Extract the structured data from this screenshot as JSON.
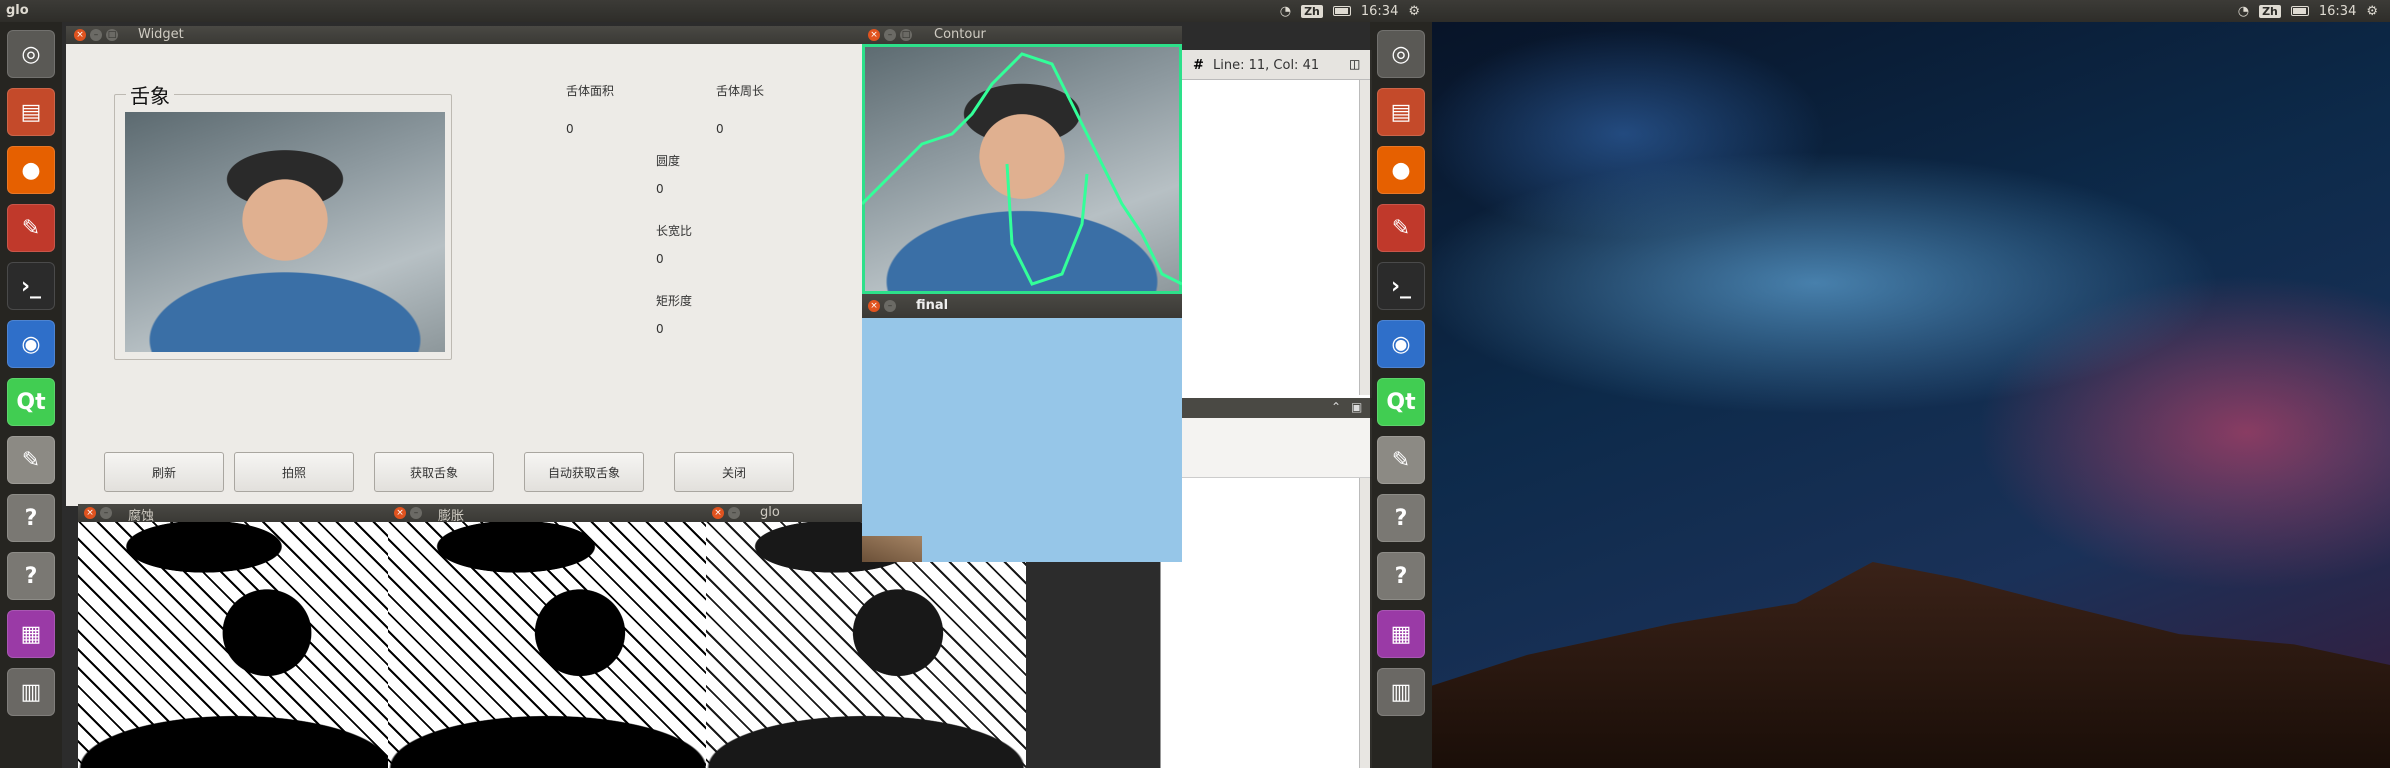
{
  "left_screen": {
    "panel_title": "glo",
    "time": "16:34",
    "ime": "Zh"
  },
  "right_screen": {
    "time": "16:34",
    "ime": "Zh"
  },
  "launcher_icons": [
    "ubuntu-logo-icon",
    "file-manager-icon",
    "firefox-icon",
    "settings-icon",
    "terminal-icon",
    "chromium-icon",
    "qt-creator-icon",
    "text-editor-icon",
    "unknown-app-icon",
    "unknown-app-icon",
    "workspace-switcher-icon",
    "trash-icon"
  ],
  "widget": {
    "title": "Widget",
    "group_title": "舌象",
    "metrics": [
      {
        "label": "舌体面积",
        "value": "0"
      },
      {
        "label": "舌体周长",
        "value": "0"
      },
      {
        "label": "圆度",
        "value": "0"
      },
      {
        "label": "长宽比",
        "value": "0"
      },
      {
        "label": "矩形度",
        "value": "0"
      }
    ],
    "buttons": [
      "刷新",
      "拍照",
      "获取舌象",
      "自动获取舌象",
      "关闭"
    ]
  },
  "contour": {
    "title": "Contour"
  },
  "final": {
    "title": "final",
    "bg_color": "#96c6e8"
  },
  "editor": {
    "status": "Line: 11, Col: 41",
    "hash": "#"
  },
  "bw_windows": [
    {
      "title": "腐蚀"
    },
    {
      "title": "膨胀"
    },
    {
      "title": "glo"
    }
  ]
}
